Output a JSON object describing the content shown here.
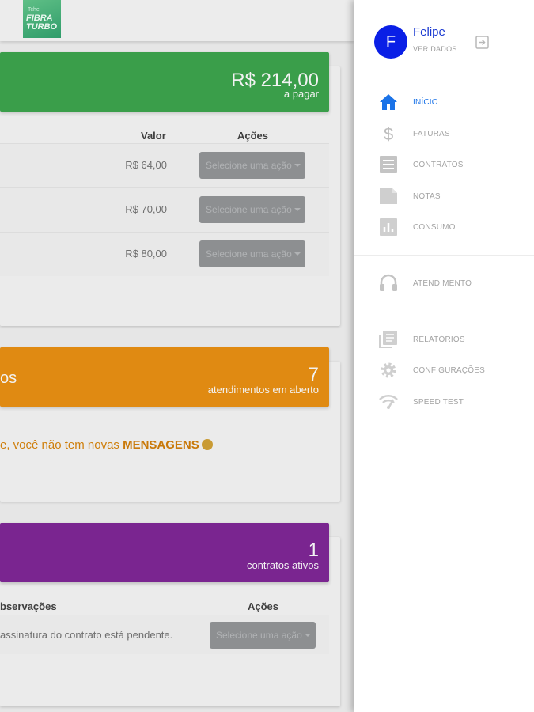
{
  "header": {
    "logo_line1": "Tche",
    "logo_line2": "FIBRA",
    "logo_line3": "TURBO"
  },
  "faturas_card": {
    "amount": "R$ 214,00",
    "amount_sub": "a pagar",
    "col_valor": "Valor",
    "col_acoes": "Ações",
    "rows": [
      {
        "valor": "R$ 64,00",
        "acao": "Selecione uma ação"
      },
      {
        "valor": "R$ 70,00",
        "acao": "Selecione uma ação"
      },
      {
        "valor": "R$ 80,00",
        "acao": "Selecione uma ação"
      }
    ]
  },
  "atendimentos_card": {
    "title_fragment": "os",
    "count": "7",
    "count_sub": "atendimentos em aberto",
    "message_prefix": "e, você não tem novas ",
    "message_bold": "MENSAGENS"
  },
  "contratos_card": {
    "count": "1",
    "count_sub": "contratos ativos",
    "col_obs": "bservações",
    "col_acoes": "Ações",
    "obs_text": "assinatura do contrato está pendente.",
    "acao": "Selecione uma ação"
  },
  "drawer": {
    "avatar_letter": "F",
    "user_name": "Felipe",
    "user_sub": "VER DADOS",
    "nav": [
      {
        "label": "INÍCIO",
        "icon": "home-icon",
        "active": true
      },
      {
        "label": "FATURAS",
        "icon": "dollar-icon"
      },
      {
        "label": "CONTRATOS",
        "icon": "document-list-icon"
      },
      {
        "label": "NOTAS",
        "icon": "note-icon"
      },
      {
        "label": "CONSUMO",
        "icon": "chart-icon"
      },
      {
        "label": "ATENDIMENTO",
        "icon": "headset-icon"
      },
      {
        "label": "RELATÓRIOS",
        "icon": "reports-icon"
      },
      {
        "label": "CONFIGURAÇÕES",
        "icon": "gear-icon"
      },
      {
        "label": "SPEED TEST",
        "icon": "wifi-speed-icon"
      }
    ]
  },
  "colors": {
    "green_header": "#3a9e4a",
    "orange_header": "#e08a12",
    "purple_header": "#7a2590",
    "accent_blue": "#1b73e8",
    "avatar_blue": "#0a1fe6"
  }
}
